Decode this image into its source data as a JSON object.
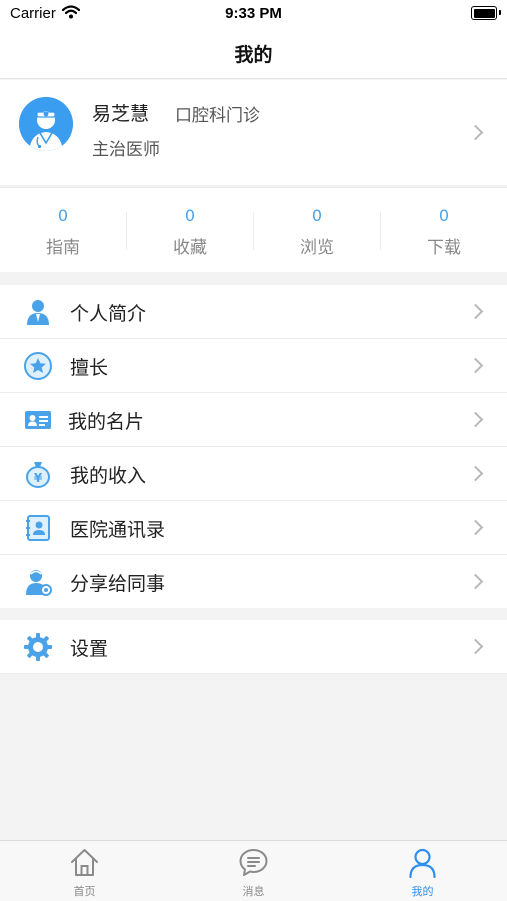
{
  "status_bar": {
    "carrier": "Carrier",
    "time": "9:33 PM"
  },
  "nav": {
    "title": "我的"
  },
  "profile": {
    "name": "易芝慧",
    "department": "口腔科门诊",
    "title": "主治医师"
  },
  "stats": [
    {
      "value": "0",
      "label": "指南"
    },
    {
      "value": "0",
      "label": "收藏"
    },
    {
      "value": "0",
      "label": "浏览"
    },
    {
      "value": "0",
      "label": "下载"
    }
  ],
  "menu": [
    {
      "label": "个人简介",
      "icon": "person-icon"
    },
    {
      "label": "擅长",
      "icon": "star-icon"
    },
    {
      "label": "我的名片",
      "icon": "id-card-icon"
    },
    {
      "label": "我的收入",
      "icon": "money-bag-icon"
    },
    {
      "label": "医院通讯录",
      "icon": "address-book-icon"
    },
    {
      "label": "分享给同事",
      "icon": "share-colleague-icon"
    }
  ],
  "settings": {
    "label": "设置",
    "icon": "gear-icon"
  },
  "tabs": [
    {
      "label": "首页",
      "icon": "home-icon"
    },
    {
      "label": "消息",
      "icon": "message-icon"
    },
    {
      "label": "我的",
      "icon": "user-icon"
    }
  ],
  "colors": {
    "accent": "#2f8ff0",
    "icon_blue": "#4aa3e8",
    "stat_value": "#4aa3e8",
    "background": "#f3f3f3"
  }
}
